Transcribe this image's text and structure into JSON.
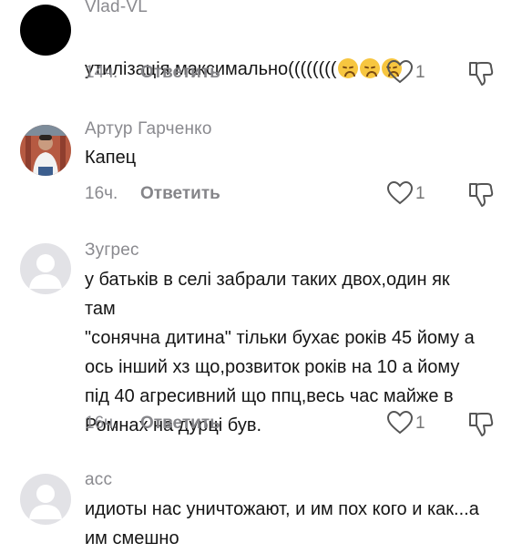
{
  "comments": [
    {
      "username": "Vlad-VL",
      "text": "утилізація максимально((((((((",
      "emoji": "disappointed-face-emoji",
      "time": "14ч.",
      "reply_label": "Ответить",
      "likes": "1"
    },
    {
      "username": "Артур Гарченко",
      "text": "Капец",
      "time": "16ч.",
      "reply_label": "Ответить",
      "likes": "1"
    },
    {
      "username": "Зугрес",
      "text": "у батьків в селі забрали таких двох,один як там\n\"сонячна дитина\" тільки бухає років 45 йому а\nось інший хз що,розвиток років на 10 а йому\nпід 40 агресивний що ппц,весь час майже в\nРомнах на дурці був.",
      "time": "16ч.",
      "reply_label": "Ответить",
      "likes": "1"
    },
    {
      "username": "асс",
      "text": "идиоты нас уничтожают, и им пох кого и как...а\nим смешно"
    }
  ],
  "icons": {
    "like": "heart-outline-icon",
    "dislike": "thumbs-down-icon",
    "default_avatar": "default-user-avatar"
  },
  "colors": {
    "text": "#151515",
    "secondary": "#8a8a8f",
    "background": "#ffffff"
  }
}
